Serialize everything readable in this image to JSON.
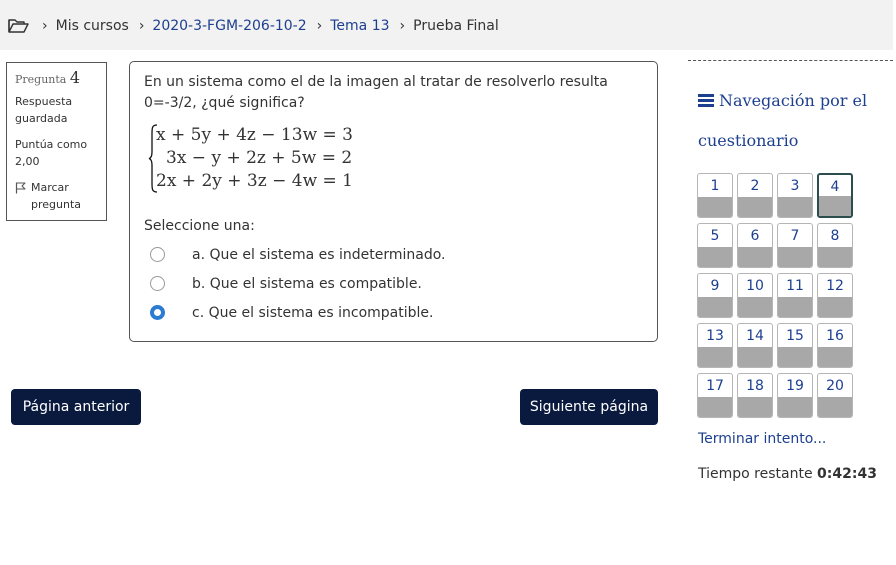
{
  "breadcrumb": {
    "items": [
      {
        "label": "Mis cursos",
        "link": false
      },
      {
        "label": "2020-3-FGM-206-10-2",
        "link": true
      },
      {
        "label": "Tema 13",
        "link": true
      },
      {
        "label": "Prueba Final",
        "link": false
      }
    ]
  },
  "question_info": {
    "label": "Pregunta",
    "number": "4",
    "state": "Respuesta guardada",
    "grade": "Puntúa como 2,00",
    "flag_label": "Marcar pregunta"
  },
  "question": {
    "text": "En un sistema como el de la imagen al tratar de resolverlo resulta 0=-3/2, ¿qué significa?",
    "equations": [
      "x + 5y + 4z − 13w = 3",
      "3x − y + 2z + 5w = 2",
      "2x + 2y + 3z − 4w = 1"
    ],
    "prompt": "Seleccione una:",
    "answers": [
      {
        "label": "a. Que el sistema es indeterminado.",
        "checked": false
      },
      {
        "label": "b. Que el sistema es compatible.",
        "checked": false
      },
      {
        "label": "c. Que el sistema es incompatible.",
        "checked": true
      }
    ]
  },
  "buttons": {
    "prev": "Página anterior",
    "next": "Siguiente página"
  },
  "quiz_nav": {
    "title": "Navegación por el cuestionario",
    "questions": [
      "1",
      "2",
      "3",
      "4",
      "5",
      "6",
      "7",
      "8",
      "9",
      "10",
      "11",
      "12",
      "13",
      "14",
      "15",
      "16",
      "17",
      "18",
      "19",
      "20"
    ],
    "current": "4",
    "finish_label": "Terminar intento...",
    "time_label": "Tiempo restante",
    "time_value": "0:42:43"
  },
  "colors": {
    "link": "#1d3f8f",
    "button_bg": "#0a1a3f",
    "radio_selected": "#2b7bd3"
  }
}
